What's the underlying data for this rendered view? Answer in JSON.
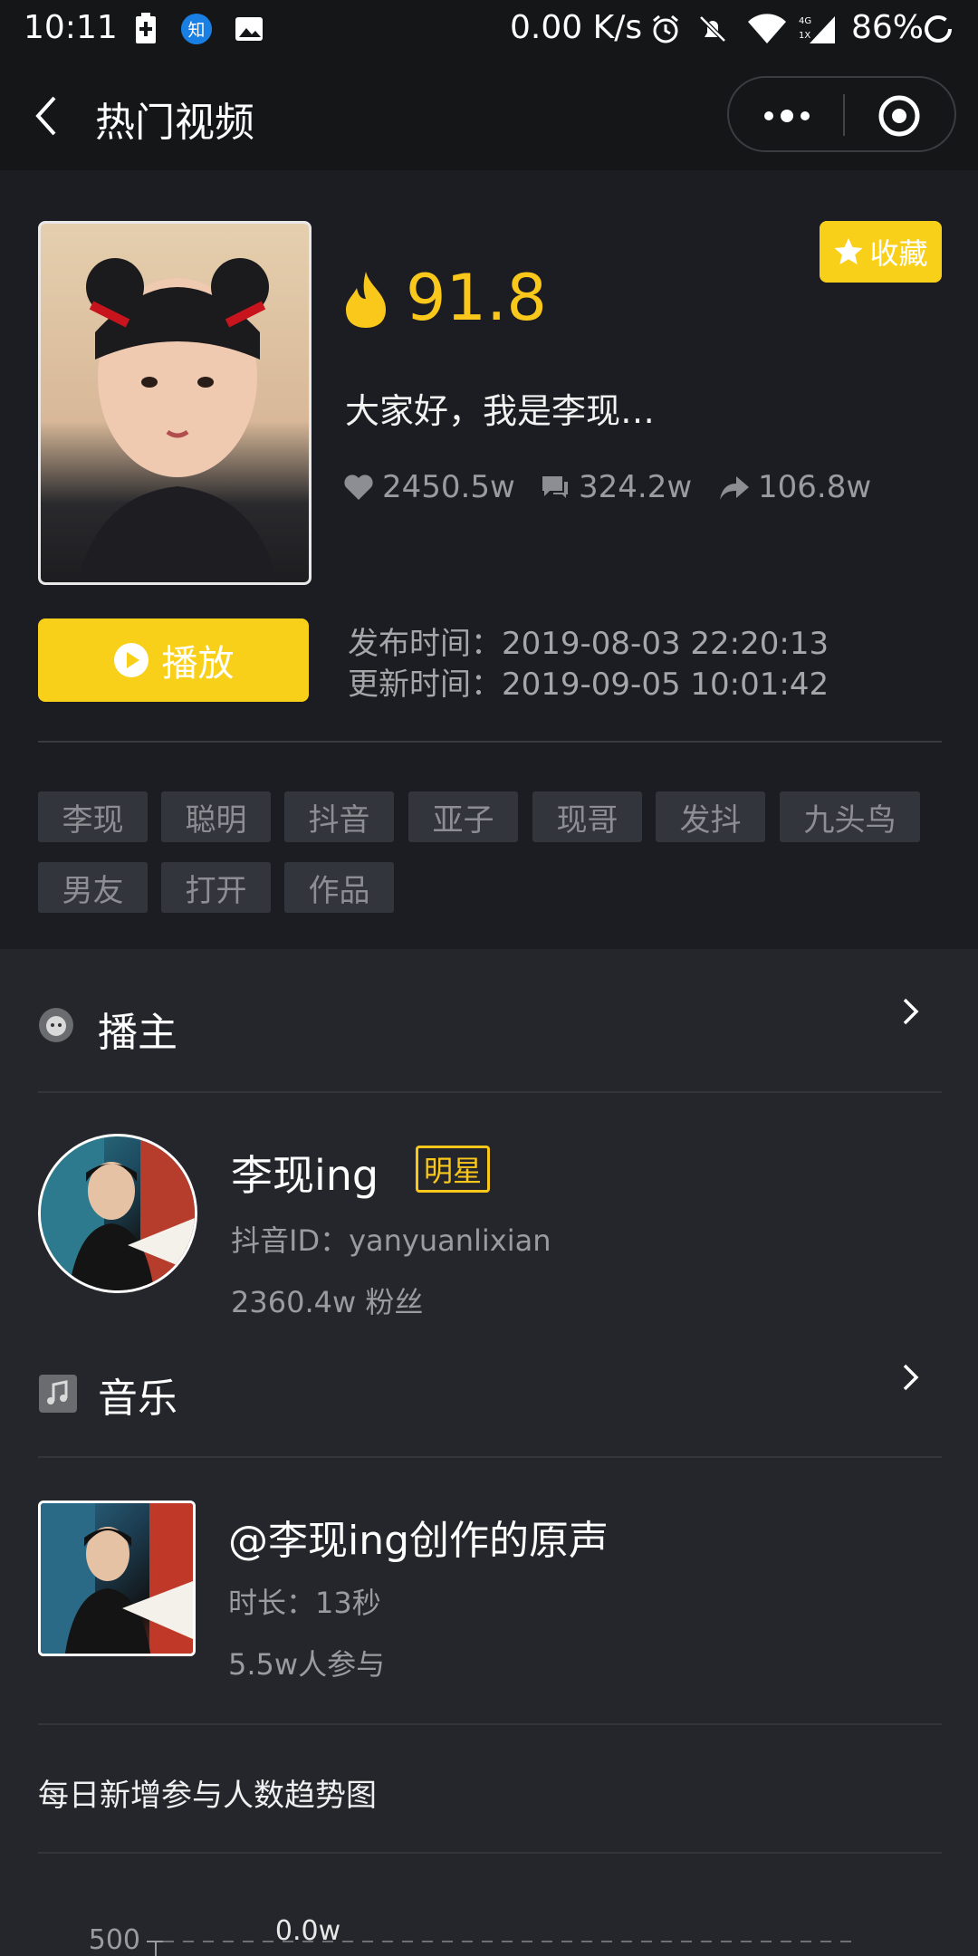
{
  "status_bar": {
    "time": "10:11",
    "net_speed": "0.00 K/s",
    "signal_label": "4G",
    "signal_sub": "1X",
    "battery": "86%"
  },
  "nav": {
    "title": "热门视频"
  },
  "video": {
    "collect_label": "收藏",
    "heat": "91.8",
    "description": "大家好，我是李现…",
    "likes": "2450.5w",
    "comments": "324.2w",
    "shares": "106.8w",
    "play_label": "播放",
    "publish_time": "发布时间：2019-08-03 22:20:13",
    "update_time": "更新时间：2019-09-05 10:01:42",
    "tags": [
      "李现",
      "聪明",
      "抖音",
      "亚子",
      "现哥",
      "发抖",
      "九头鸟",
      "男友",
      "打开",
      "作品"
    ]
  },
  "author_section": {
    "title": "播主",
    "name": "李现ing",
    "badge": "明星",
    "douyin_id": "抖音ID：yanyuanlixian",
    "fans": "2360.4w 粉丝"
  },
  "music_section": {
    "title": "音乐",
    "name": "@李现ing创作的原声",
    "duration": "时长：13秒",
    "participants": "5.5w人参与"
  },
  "trend": {
    "title": "每日新增参与人数趋势图"
  },
  "chart_data": {
    "type": "line",
    "title": "",
    "ylabel": "",
    "y_tick_labels": [
      "500"
    ],
    "data_labels": [
      "0.0w"
    ],
    "ylim": [
      0,
      500
    ]
  },
  "colors": {
    "accent": "#f9d019",
    "heat": "#f9c81b",
    "background": "#25262c"
  }
}
